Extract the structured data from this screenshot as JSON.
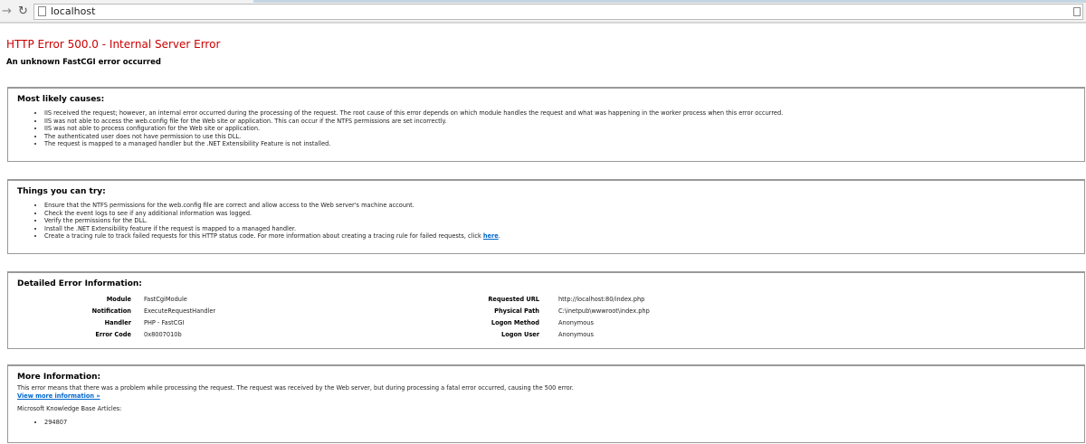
{
  "browser": {
    "url": "localhost"
  },
  "error": {
    "title": "HTTP Error 500.0 - Internal Server Error",
    "subtitle": "An unknown FastCGI error occurred"
  },
  "causes": {
    "heading": "Most likely causes:",
    "items": [
      "IIS received the request; however, an internal error occurred during the processing of the request. The root cause of this error depends on which module handles the request and what was happening in the worker process when this error occurred.",
      "IIS was not able to access the web.config file for the Web site or application. This can occur if the NTFS permissions are set incorrectly.",
      "IIS was not able to process configuration for the Web site or application.",
      "The authenticated user does not have permission to use this DLL.",
      "The request is mapped to a managed handler but the .NET Extensibility Feature is not installed."
    ]
  },
  "try": {
    "heading": "Things you can try:",
    "items": [
      "Ensure that the NTFS permissions for the web.config file are correct and allow access to the Web server's machine account.",
      "Check the event logs to see if any additional information was logged.",
      "Verify the permissions for the DLL.",
      "Install the .NET Extensibility feature if the request is mapped to a managed handler."
    ],
    "last_item": "Create a tracing rule to track failed requests for this HTTP status code. For more information about creating a tracing rule for failed requests, click ",
    "link": "here",
    "period": "."
  },
  "details": {
    "heading": "Detailed Error Information:",
    "left": [
      {
        "label": "Module",
        "value": "FastCgiModule"
      },
      {
        "label": "Notification",
        "value": "ExecuteRequestHandler"
      },
      {
        "label": "Handler",
        "value": "PHP - FastCGI"
      },
      {
        "label": "Error Code",
        "value": "0x8007010b"
      }
    ],
    "right": [
      {
        "label": "Requested URL",
        "value": "http://localhost:80/index.php"
      },
      {
        "label": "Physical Path",
        "value": "C:\\inetpub\\wwwroot\\index.php"
      },
      {
        "label": "Logon Method",
        "value": "Anonymous"
      },
      {
        "label": "Logon User",
        "value": "Anonymous"
      }
    ]
  },
  "more": {
    "heading": "More Information:",
    "text": "This error means that there was a problem while processing the request. The request was received by the Web server, but during processing a fatal error occurred, causing the 500 error.",
    "link": "View more information »",
    "kb_label": "Microsoft Knowledge Base Articles:",
    "kb_items": [
      "294807"
    ]
  }
}
